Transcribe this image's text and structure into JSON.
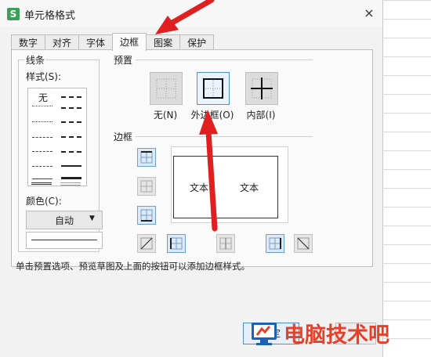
{
  "window": {
    "title": "单元格格式",
    "app_icon_letter": "S",
    "close_glyph": "×"
  },
  "tabs": [
    {
      "label": "数字"
    },
    {
      "label": "对齐"
    },
    {
      "label": "字体"
    },
    {
      "label": "边框",
      "active": true
    },
    {
      "label": "图案"
    },
    {
      "label": "保护"
    }
  ],
  "line_group": {
    "title": "线条",
    "style_label": "样式(S):",
    "none_label": "无",
    "color_label": "颜色(C):",
    "color_value": "自动"
  },
  "presets": {
    "title": "预置",
    "none_label": "无(N)",
    "outline_label": "外边框(O)",
    "inside_label": "内部(I)",
    "selected": "outline"
  },
  "border": {
    "title": "边框",
    "preview_text_left": "文本",
    "preview_text_right": "文本"
  },
  "hint": "单击预置选项、预览草图及上面的按钮可以添加边框样式。",
  "buttons": {
    "ok_label": "确定"
  },
  "watermark": {
    "text": "电脑技术吧"
  },
  "colors": {
    "accent": "#4a90d9",
    "arrow": "#e02020",
    "watermark": "#e4412b",
    "app_icon": "#3aa05a"
  }
}
